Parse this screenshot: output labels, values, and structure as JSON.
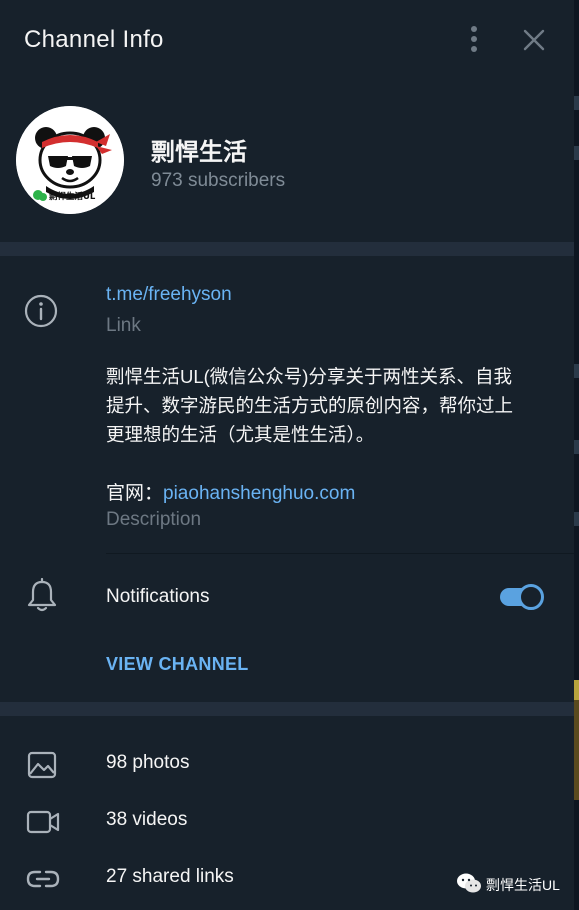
{
  "header": {
    "title": "Channel Info"
  },
  "profile": {
    "name": "剽悍生活",
    "subscribers": "973 subscribers",
    "avatar_caption": "剽悍生活UL"
  },
  "info": {
    "link": "t.me/freehyson",
    "link_caption": "Link",
    "description_lines": [
      "剽悍生活UL(微信公众号)分享关于两性关系、自我",
      "提升、数字游民的生活方式的原创内容，帮你过上",
      "更理想的生活（尤其是性生活）。"
    ],
    "website_prefix": "官网：",
    "website_link": "piaohanshenghuo.com",
    "description_caption": "Description"
  },
  "notifications": {
    "label": "Notifications",
    "enabled": true
  },
  "view_channel": "VIEW CHANNEL",
  "media": [
    {
      "label": "98 photos",
      "icon": "photo-icon"
    },
    {
      "label": "38 videos",
      "icon": "video-icon"
    },
    {
      "label": "27 shared links",
      "icon": "link-icon"
    }
  ],
  "watermark": "剽悍生活UL",
  "colors": {
    "background": "#17212b",
    "separator": "#232e3c",
    "accent": "#6ab3f3",
    "muted": "#6d7883"
  }
}
